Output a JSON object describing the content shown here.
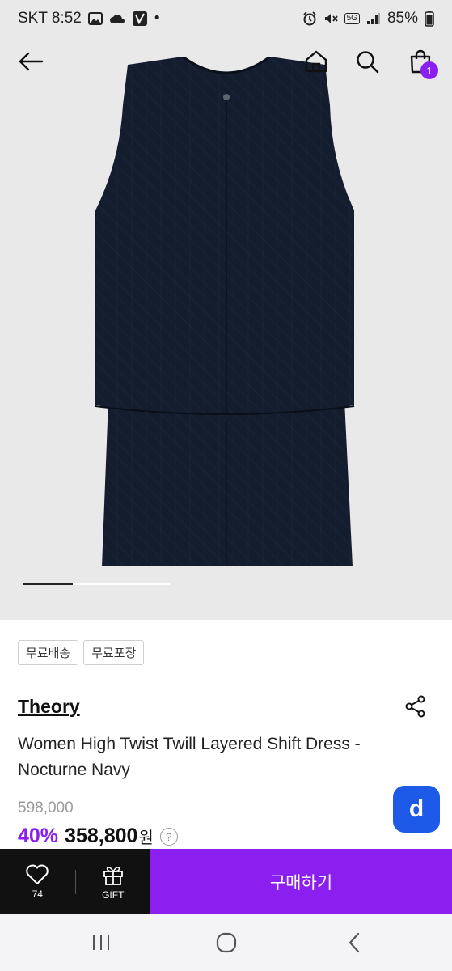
{
  "status_bar": {
    "carrier_time": "SKT 8:52",
    "dot": "•",
    "network": "5G",
    "battery": "85%",
    "icons": [
      "image-icon",
      "cloud-icon",
      "app-icon",
      "alarm-icon",
      "mute-icon",
      "signal-icon",
      "battery-icon"
    ]
  },
  "nav": {
    "back_icon": "arrow-left-icon",
    "home_icon": "home-icon",
    "search_icon": "search-icon",
    "cart_icon": "shopping-bag-icon",
    "cart_count": "1"
  },
  "gallery": {
    "image_subject": "navy-layered-shift-dress",
    "current_index": 1,
    "total": 3
  },
  "tags": [
    "무료배송",
    "무료포장"
  ],
  "product": {
    "brand": "Theory",
    "title": "Women High Twist Twill Layered Shift Dress - Nocturne Navy",
    "original_price": "598,000",
    "discount": "40%",
    "sale_price": "358,800",
    "currency": "원",
    "help": "?"
  },
  "fab": {
    "label": "d"
  },
  "action_bar": {
    "like_count": "74",
    "gift_label": "GIFT",
    "buy_label": "구매하기"
  },
  "colors": {
    "accent": "#8a1ff0",
    "fab_blue": "#1e5ae8",
    "dark": "#111111",
    "hero_bg": "#e9e9ea"
  }
}
